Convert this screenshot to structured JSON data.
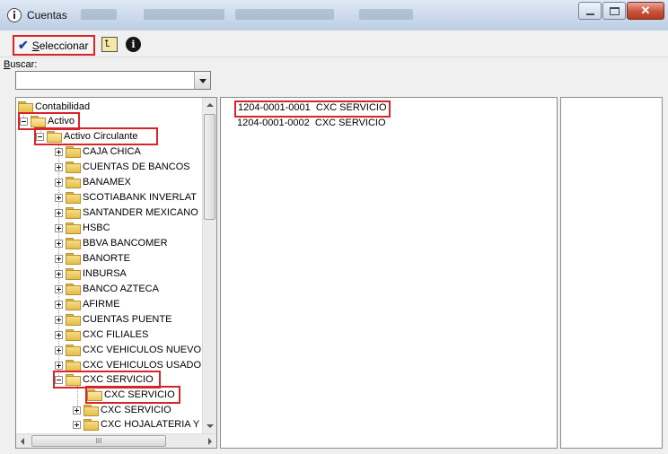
{
  "window": {
    "title": "Cuentas"
  },
  "toolbar": {
    "select_label": "Seleccionar",
    "info_glyph": "i"
  },
  "search": {
    "label": "Buscar:",
    "value": ""
  },
  "tree": {
    "root": "Contabilidad",
    "activo": "Activo",
    "circulante": "Activo Circulante",
    "groups": [
      "CAJA CHICA",
      "CUENTAS DE BANCOS",
      "BANAMEX",
      "SCOTIABANK INVERLAT",
      "SANTANDER MEXICANO",
      "HSBC",
      "BBVA BANCOMER",
      "BANORTE",
      "INBURSA",
      "BANCO AZTECA",
      "AFIRME",
      "CUENTAS PUENTE",
      "CXC FILIALES",
      "CXC VEHICULOS NUEVO",
      "CXC VEHICULOS USADO",
      "CXC SERVICIO"
    ],
    "children": [
      "CXC SERVICIO",
      "CXC SERVICIO",
      "CXC HOJALATERIA Y"
    ]
  },
  "accounts": [
    {
      "code": "1204-0001-0001",
      "name": "CXC SERVICIO"
    },
    {
      "code": "1204-0001-0002",
      "name": "CXC SERVICIO"
    }
  ],
  "hscroll_glyph": "III",
  "colors": {
    "highlight": "#d8232a",
    "folder": "#e5bd4c",
    "check": "#1a3fa8"
  },
  "icons": {
    "title": "info-icon",
    "select": "checkmark-icon",
    "up": "folder-up-icon",
    "info": "info-icon",
    "folder": "folder-icon"
  }
}
